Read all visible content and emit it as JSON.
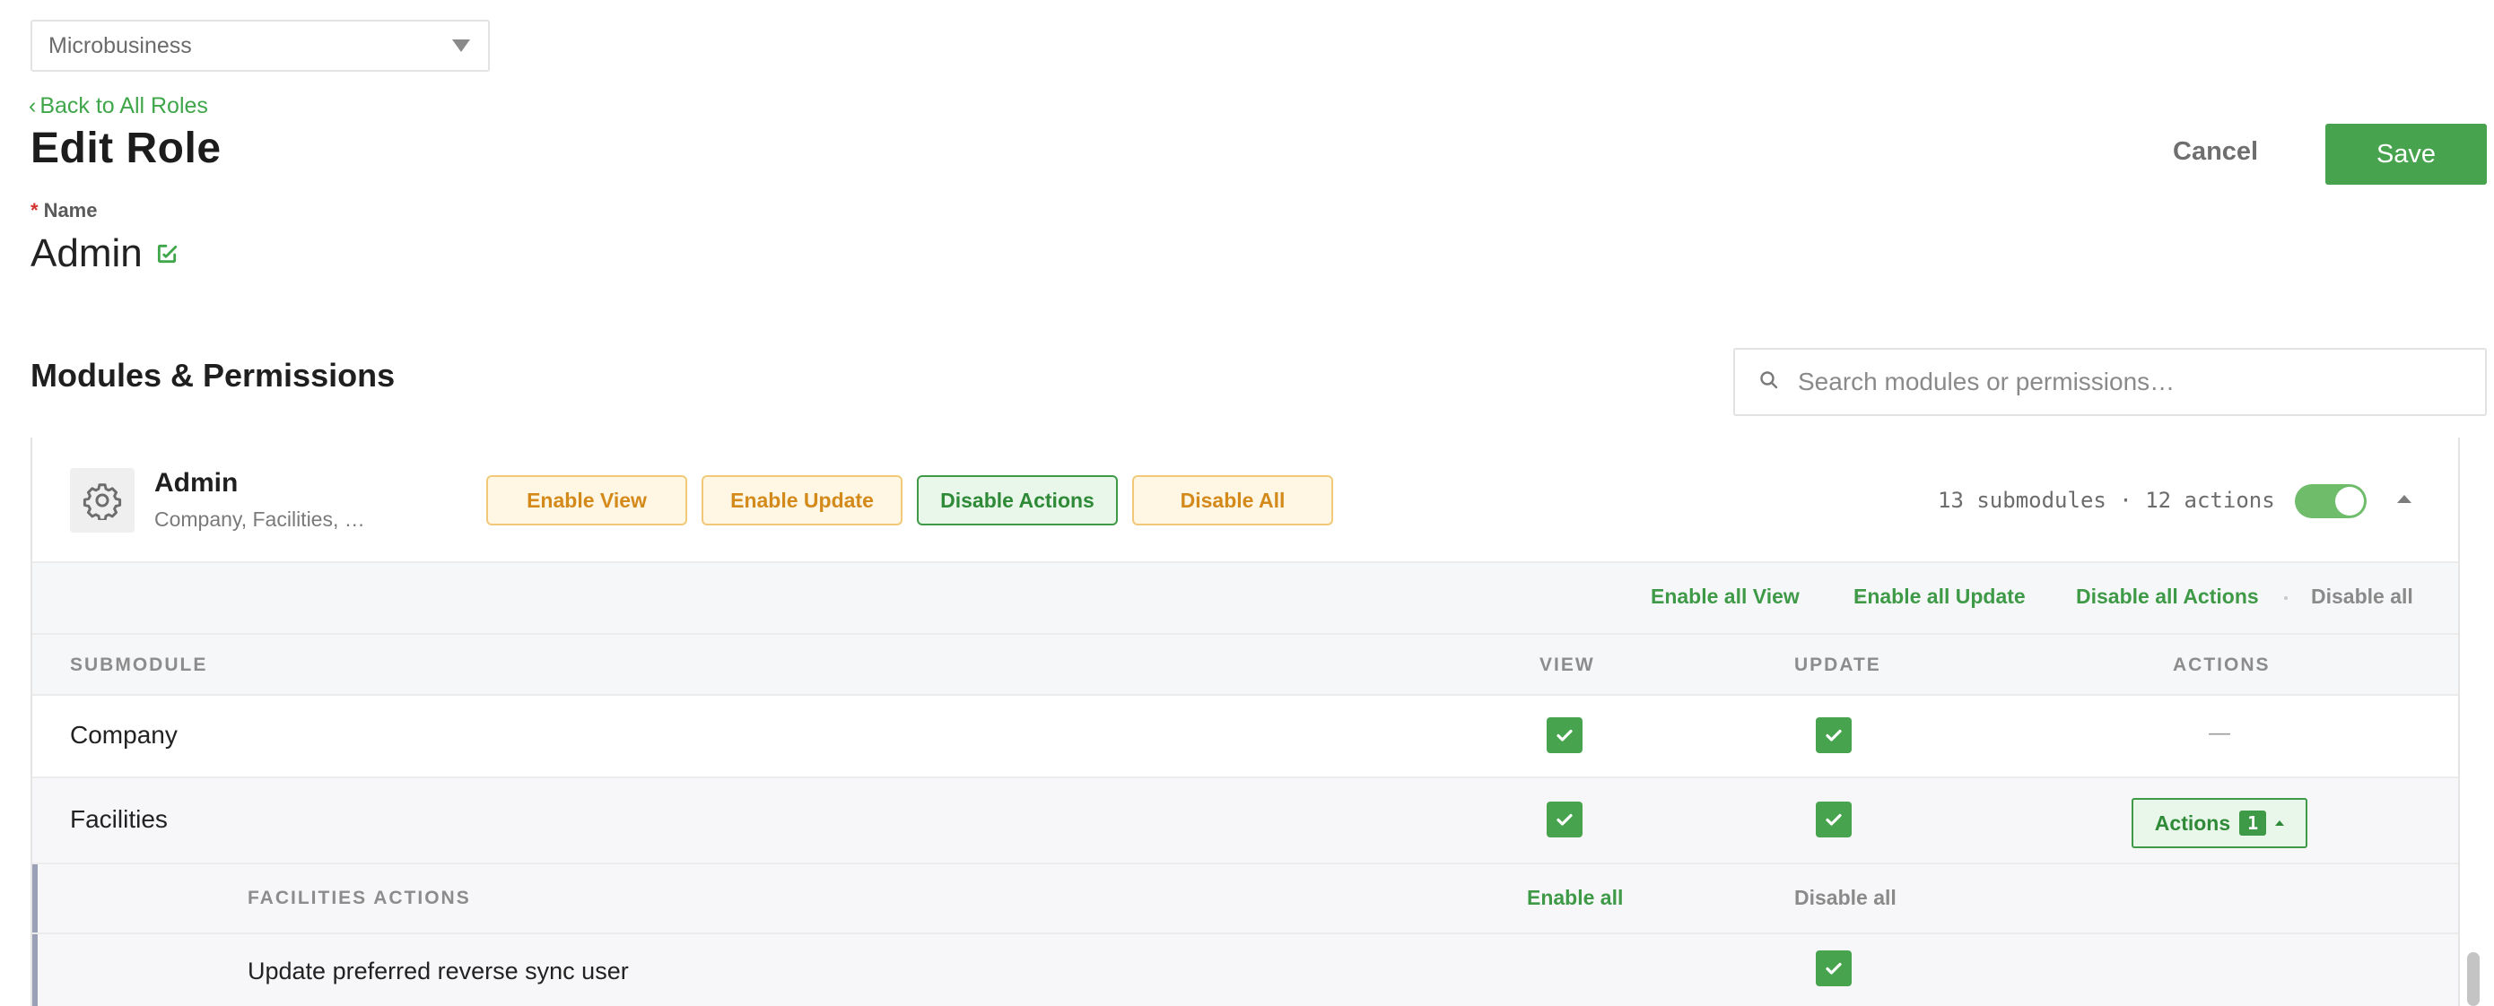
{
  "org_select": {
    "value": "Microbusiness"
  },
  "nav": {
    "back_label": "Back to All Roles"
  },
  "page": {
    "title": "Edit Role"
  },
  "toolbar": {
    "cancel_label": "Cancel",
    "save_label": "Save"
  },
  "role": {
    "name_label": "Name",
    "required_mark": "*",
    "name_value": "Admin"
  },
  "permissions": {
    "title": "Modules & Permissions",
    "search_placeholder": "Search modules or permissions…"
  },
  "module": {
    "name": "Admin",
    "submodules_preview": "Company, Facilities, …",
    "icon": "gear-icon",
    "buttons": {
      "enable_view": "Enable View",
      "enable_update": "Enable Update",
      "disable_actions": "Disable Actions",
      "disable_all": "Disable All"
    },
    "count_text": "13 submodules · 12 actions",
    "enabled": true,
    "bulk": {
      "enable_all_view": "Enable all View",
      "enable_all_update": "Enable all Update",
      "disable_all_actions": "Disable all Actions",
      "disable_all": "Disable all"
    },
    "columns": {
      "submodule": "SUBMODULE",
      "view": "VIEW",
      "update": "UPDATE",
      "actions": "ACTIONS"
    },
    "rows": [
      {
        "name": "Company",
        "view": true,
        "update": true,
        "actions": "—"
      },
      {
        "name": "Facilities",
        "view": true,
        "update": true,
        "actions_label": "Actions",
        "actions_count": "1"
      }
    ],
    "facilities_actions": {
      "header": "FACILITIES ACTIONS",
      "enable_all": "Enable all",
      "disable_all": "Disable all",
      "items": [
        {
          "name": "Update preferred reverse sync user",
          "enabled": true
        }
      ]
    }
  },
  "colors": {
    "accent": "#48a34e",
    "warn": "#d48a1a",
    "warn_bg": "#fff6e3"
  }
}
